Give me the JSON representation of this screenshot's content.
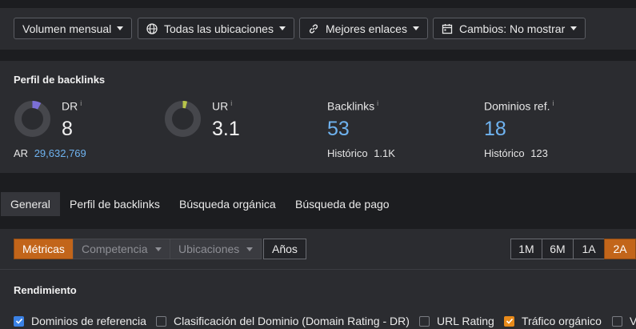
{
  "filters": {
    "volume": "Volumen mensual",
    "locations": "Todas las ubicaciones",
    "links": "Mejores enlaces",
    "changes": "Cambios: No mostrar"
  },
  "profile": {
    "title": "Perfil de backlinks",
    "dr": {
      "label": "DR",
      "value": "8",
      "info": "i",
      "gauge_fraction": 0.08
    },
    "ar": {
      "label": "AR",
      "value": "29,632,769"
    },
    "ur": {
      "label": "UR",
      "value": "3.1",
      "info": "i",
      "gauge_fraction": 0.031
    },
    "backlinks": {
      "label": "Backlinks",
      "value": "53",
      "info": "i",
      "history_label": "Histórico",
      "history_value": "1.1K"
    },
    "ref_domains": {
      "label": "Dominios ref.",
      "value": "18",
      "info": "i",
      "history_label": "Histórico",
      "history_value": "123"
    }
  },
  "tabs": [
    "General",
    "Perfil de backlinks",
    "Búsqueda orgánica",
    "Búsqueda de pago"
  ],
  "segments": {
    "metrics": "Métricas",
    "competition": "Competencia",
    "locations": "Ubicaciones",
    "years": "Años"
  },
  "ranges": [
    "1M",
    "6M",
    "1A",
    "2A"
  ],
  "performance": {
    "title": "Rendimiento"
  },
  "checkboxes": [
    {
      "label": "Dominios de referencia",
      "checked": true,
      "color": "#3b82e6"
    },
    {
      "label": "Clasificación del Dominio (Domain Rating - DR)",
      "checked": false
    },
    {
      "label": "URL Rating",
      "checked": false
    },
    {
      "label": "Tráfico orgánico",
      "checked": true,
      "color": "#e88a1a"
    },
    {
      "label": "V",
      "checked": false
    }
  ],
  "colors": {
    "accent_orange": "#c2651a",
    "link_blue": "#6fb3f0",
    "dr_gauge": "#7b6fd6",
    "ur_gauge": "#b8c44a"
  }
}
